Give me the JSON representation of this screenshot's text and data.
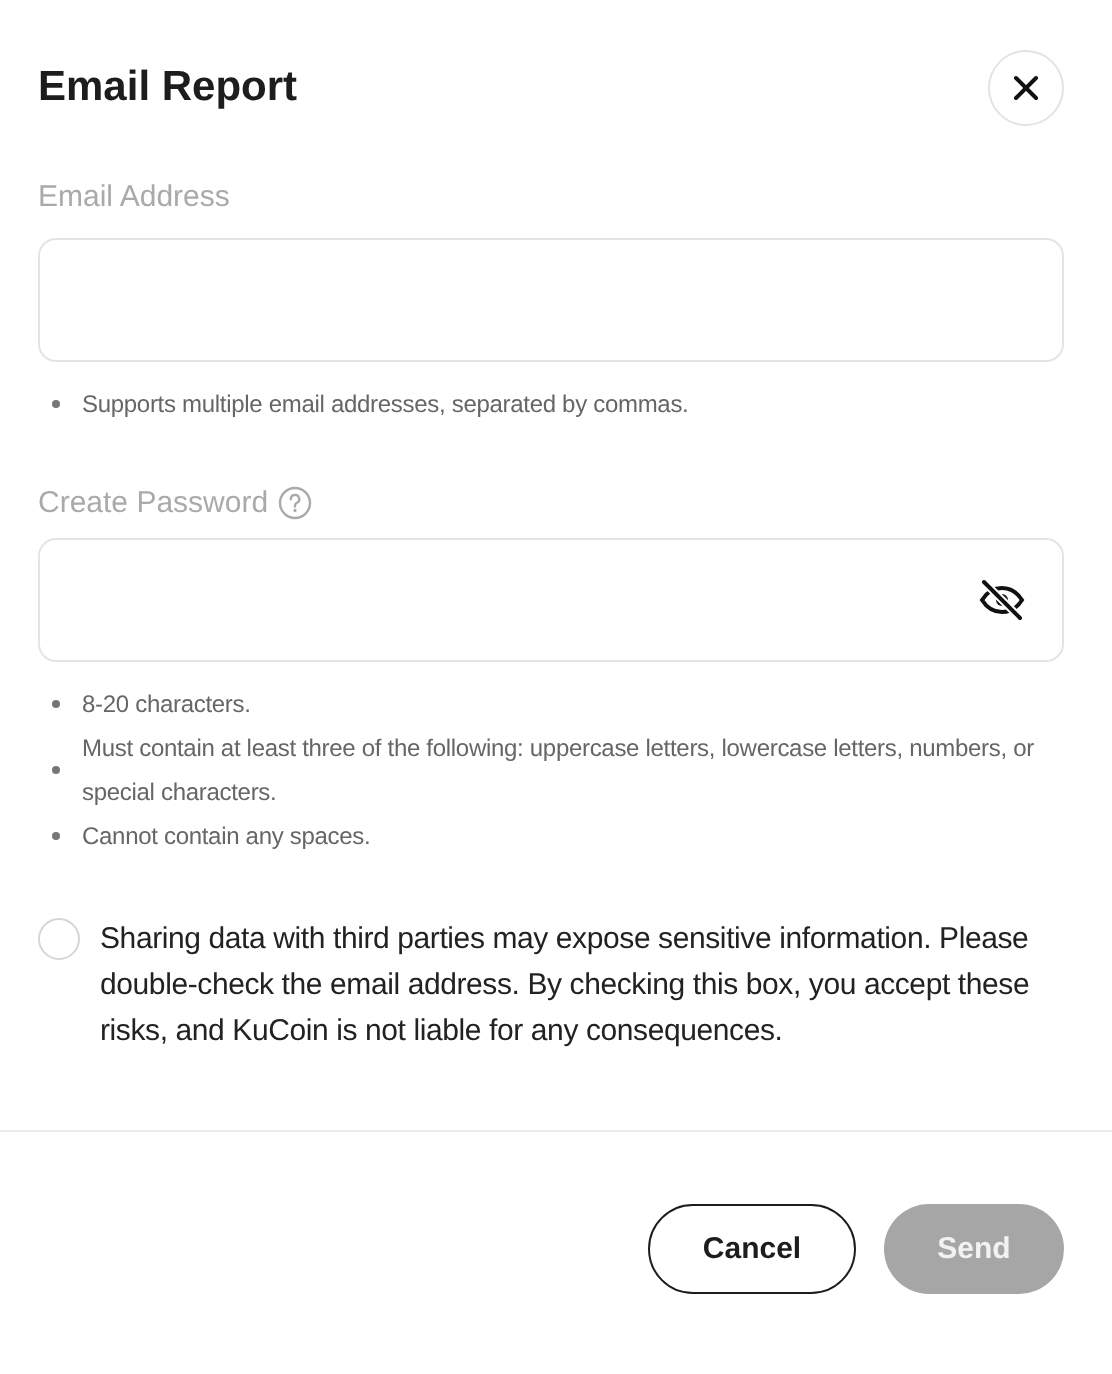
{
  "dialog": {
    "title": "Email Report"
  },
  "email_field": {
    "label": "Email Address",
    "hints": [
      "Supports multiple email addresses, separated by commas."
    ]
  },
  "password_field": {
    "label": "Create Password",
    "visible": false,
    "hints": [
      "8-20 characters.",
      "Must contain at least three of the following: uppercase letters, lowercase letters, numbers, or special characters.",
      "Cannot contain any spaces."
    ]
  },
  "consent": {
    "text": "Sharing data with third parties may expose sensitive information. Please double-check the email address. By checking this box, you accept these risks, and KuCoin is not liable for any consequences.",
    "checked": false
  },
  "buttons": [
    {
      "label": "Cancel",
      "kind": "outline",
      "disabled": false
    },
    {
      "label": "Send",
      "kind": "primary",
      "disabled": true
    }
  ]
}
